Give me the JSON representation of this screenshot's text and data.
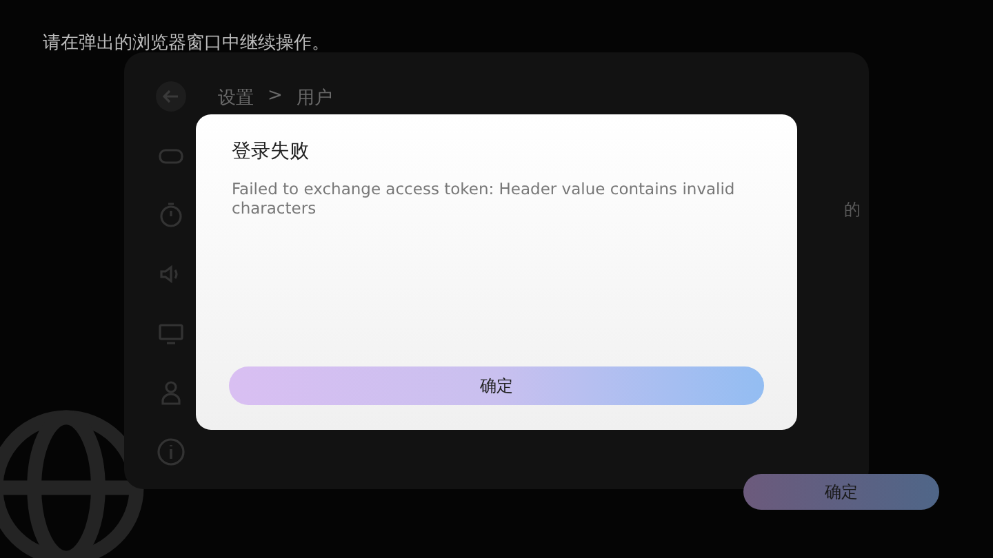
{
  "prompt": "请在弹出的浏览器窗口中继续操作。",
  "settings": {
    "breadcrumb": [
      "设置",
      ">",
      "用户"
    ],
    "description_fragment": "的",
    "confirm_button": "确定"
  },
  "dialog": {
    "title": "登录失败",
    "message": "Failed to exchange access token: Header value contains invalid characters",
    "button": "确定"
  }
}
